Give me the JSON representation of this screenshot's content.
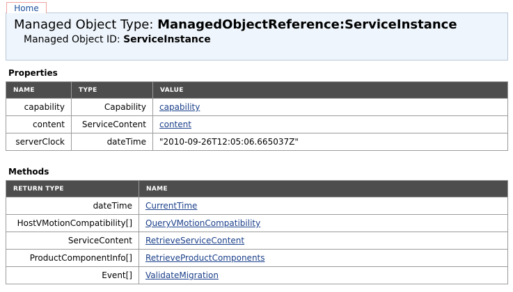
{
  "nav": {
    "home_label": "Home"
  },
  "header": {
    "type_label": "Managed Object Type: ",
    "type_value": "ManagedObjectReference:ServiceInstance",
    "id_label": "Managed Object ID: ",
    "id_value": "ServiceInstance"
  },
  "properties": {
    "title": "Properties",
    "columns": [
      "NAME",
      "TYPE",
      "VALUE"
    ],
    "rows": [
      {
        "name": "capability",
        "type": "Capability",
        "value": "capability",
        "is_link": true
      },
      {
        "name": "content",
        "type": "ServiceContent",
        "value": "content",
        "is_link": true
      },
      {
        "name": "serverClock",
        "type": "dateTime",
        "value": "\"2010-09-26T12:05:06.665037Z\"",
        "is_link": false
      }
    ]
  },
  "methods": {
    "title": "Methods",
    "columns": [
      "RETURN TYPE",
      "NAME"
    ],
    "rows": [
      {
        "return_type": "dateTime",
        "name": "CurrentTime"
      },
      {
        "return_type": "HostVMotionCompatibility[]",
        "name": "QueryVMotionCompatibility"
      },
      {
        "return_type": "ServiceContent",
        "name": "RetrieveServiceContent"
      },
      {
        "return_type": "ProductComponentInfo[]",
        "name": "RetrieveProductComponents"
      },
      {
        "return_type": "Event[]",
        "name": "ValidateMigration"
      }
    ]
  },
  "colors": {
    "header_bg": "#eef5fc",
    "table_header_bg": "#4d4d4d",
    "link": "#1a3f8a",
    "home_tab_border": "#f2a0a0"
  }
}
